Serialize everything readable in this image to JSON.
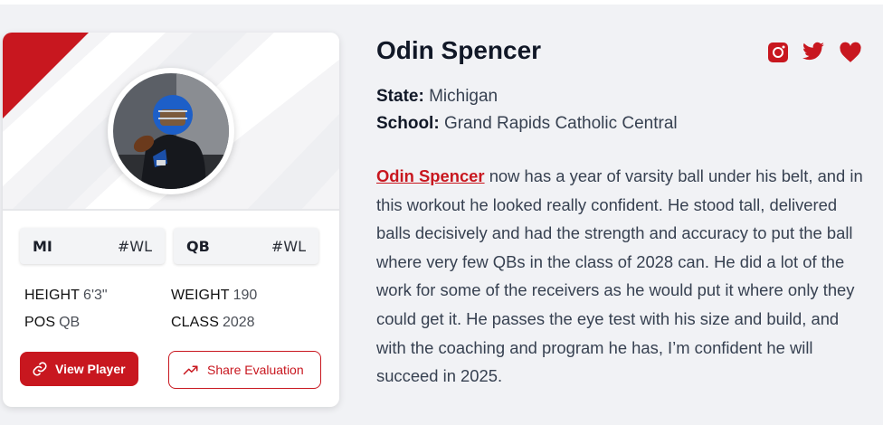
{
  "player": {
    "name": "Odin Spencer",
    "state_label": "State:",
    "state": "Michigan",
    "school_label": "School:",
    "school": "Grand Rapids Catholic Central",
    "bio_link": "Odin Spencer",
    "bio_text": " now has a year of varsity ball under his belt, and in this workout he looked really confident. He stood tall, delivered balls decisively and had the strength and accuracy to put the ball where very few QBs in the class of 2028 can. He did a lot of the work for some of the receivers as he would put it where only they could get it. He passes the eye test with his size and build, and with the coaching and program he has, I’m confident he will succeed in 2025."
  },
  "card": {
    "tags": [
      {
        "left": "MI",
        "right": "#WL"
      },
      {
        "left": "QB",
        "right": "#WL"
      }
    ],
    "stats": {
      "height_label": "HEIGHT",
      "height": "6'3\"",
      "weight_label": "WEIGHT",
      "weight": "190",
      "pos_label": "POS",
      "pos": "QB",
      "class_label": "CLASS",
      "class": "2028"
    },
    "buttons": {
      "view_player": "View Player",
      "share_evaluation": "Share Evaluation"
    }
  },
  "social": {
    "icons": [
      "instagram-icon",
      "twitter-icon",
      "heart-icon"
    ]
  },
  "colors": {
    "accent": "#c8171f",
    "page_bg": "#f1f2f5",
    "text_dark": "#111827"
  }
}
